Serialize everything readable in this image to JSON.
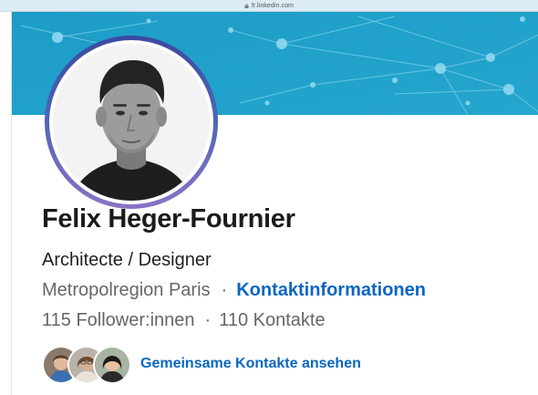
{
  "browser": {
    "url": "fr.linkedin.com"
  },
  "profile": {
    "name": "Felix Heger-Fournier",
    "headline": "Architecte / Designer",
    "location": "Metropolregion Paris",
    "separator": "·",
    "contact_info_link": "Kontaktinformationen",
    "followers": "115 Follower:innen",
    "connections": "110 Kontakte",
    "mutual_link": "Gemeinsame Kontakte ansehen"
  },
  "colors": {
    "cover": "#1ea0c8",
    "link": "#0a66c2",
    "avatar_ring": "#4b64b6"
  }
}
